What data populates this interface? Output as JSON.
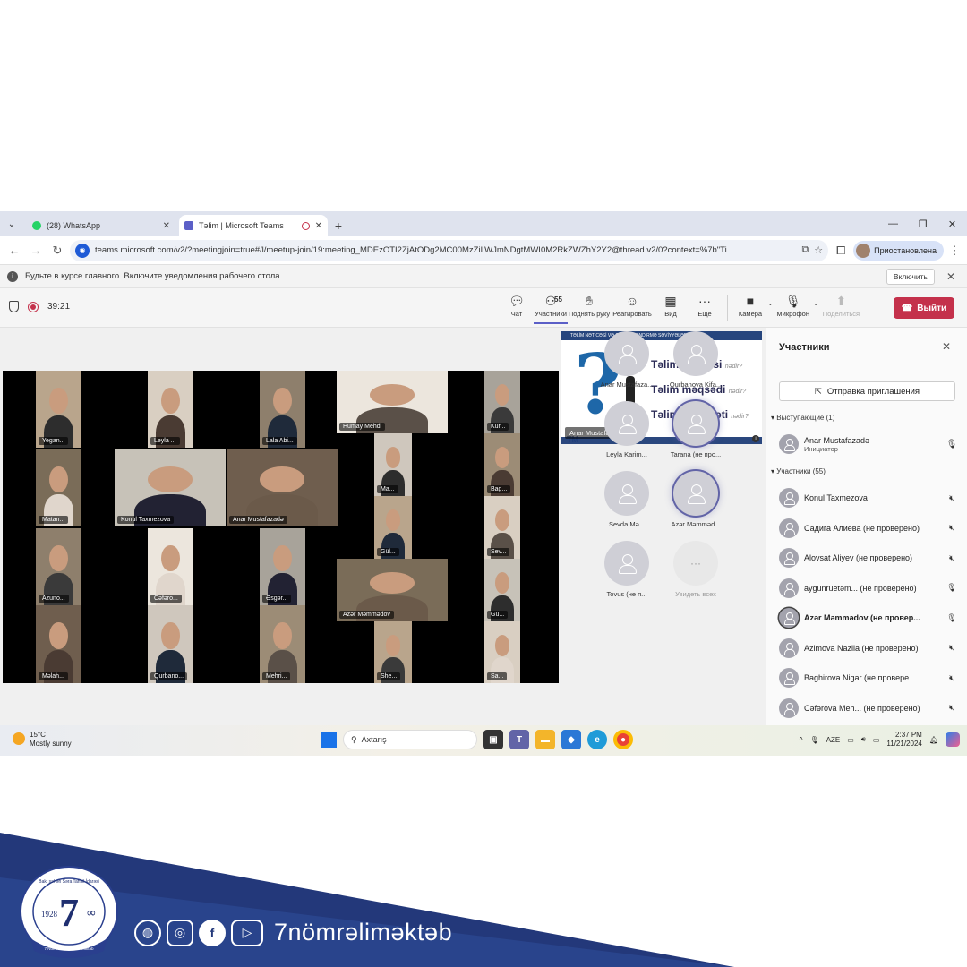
{
  "browser": {
    "tabs": [
      {
        "label": "(28) WhatsApp",
        "active": false
      },
      {
        "label": "Təlim | Microsoft Teams",
        "active": true
      }
    ],
    "url": "teams.microsoft.com/v2/?meetingjoin=true#/l/meetup-join/19:meeting_MDEzOTI2ZjAtODg2MC00MzZiLWJmNDgtMWI0M2RkZWZhY2Y2@thread.v2/0?context=%7b\"Ti...",
    "profile_label": "Приостановлена"
  },
  "notification": {
    "text": "Будьте в курсе главного. Включите уведомления рабочего стола.",
    "button": "Включить"
  },
  "meeting": {
    "timer": "39:21",
    "toolbar": {
      "chat": "Чат",
      "participants": "Участники",
      "participants_count": "55",
      "raise_hand": "Поднять руку",
      "react": "Реагировать",
      "view": "Вид",
      "more": "Еще",
      "camera": "Камера",
      "microphone": "Микрофон",
      "share": "Поделиться",
      "leave": "Выйти"
    },
    "video_tiles": [
      "Yegan...",
      "Leyla ...",
      "Lala Abi...",
      "Humay Mehdi",
      "Kur...",
      "Matan...",
      "Konul Taxmezova",
      "Anar Mustafazadə",
      "Ma...",
      "Bag...",
      "Gül...",
      "Sev...",
      "Azuno...",
      "Cəfəro...",
      "Əsgər...",
      "Azər Məmmədov",
      "Gü...",
      "Məlah...",
      "Qurbano...",
      "Mehri...",
      "She...",
      "Sa..."
    ],
    "shared_content": {
      "banner": "TƏLİM NƏTİCƏSİ VƏ QİYMƏTLƏNDİRMƏ SƏVİYYƏLƏRİ",
      "lines": [
        "Təlim nəticəsi",
        "Təlim məqsədi",
        "Təlim nailiyyəti"
      ],
      "suffix": "nədir?",
      "presenter": "Anar Mustafazadə",
      "mark": "TM"
    },
    "avatar_tiles": [
      {
        "name": "Anar Mustafaza...",
        "speaking": false
      },
      {
        "name": "Qurbanova Kifa...",
        "speaking": false
      },
      {
        "name": "Leyla Karim...",
        "speaking": false
      },
      {
        "name": "Tarana (не про...",
        "speaking": true
      },
      {
        "name": "Sevda Mə...",
        "speaking": false
      },
      {
        "name": "Azər Məmməd...",
        "speaking": true
      },
      {
        "name": "Tovus (не п...",
        "speaking": false
      }
    ],
    "see_all": "Увидеть всех"
  },
  "participants_panel": {
    "title": "Участники",
    "invite_button": "Отправка приглашения",
    "presenters_header": "Выступающие (1)",
    "presenter": {
      "name": "Anar Mustafazadə",
      "role": "Инициатор"
    },
    "attendees_header": "Участники (55)",
    "attendees": [
      {
        "name": "Konul Taxmezova",
        "muted": true
      },
      {
        "name": "Садига Алиева (не проверено)",
        "muted": true
      },
      {
        "name": "Alovsat Aliyev (не проверено)",
        "muted": true
      },
      {
        "name": "aygunruetəm... (не проверено)",
        "muted": false
      },
      {
        "name": "Azər Məmmədov (не провер...",
        "muted": false
      },
      {
        "name": "Azimova Nazila (не проверено)",
        "muted": true
      },
      {
        "name": "Baghirova Nigar (не провере...",
        "muted": true
      },
      {
        "name": "Cəfərova Meh... (не проверено)",
        "muted": true
      }
    ]
  },
  "taskbar": {
    "temperature": "15°C",
    "weather": "Mostly sunny",
    "search_placeholder": "Axtarış",
    "language": "AZE",
    "time": "2:37 PM",
    "date": "11/21/2024"
  },
  "footer": {
    "brand": "7nömrəliməktəb",
    "logo_year": "1928",
    "logo_number": "7",
    "logo_symbol": "∞",
    "logo_top_text": "Bakı şəhəri Səra Tahsil İdarəsi",
    "logo_bottom_text": "7 Nömrəli Tam Orta Məktəb"
  },
  "colors": {
    "accent": "#5b5fc7",
    "leave": "#c4314b",
    "footer_navy": "#23387a",
    "footer_blue": "#2f4e9a"
  }
}
